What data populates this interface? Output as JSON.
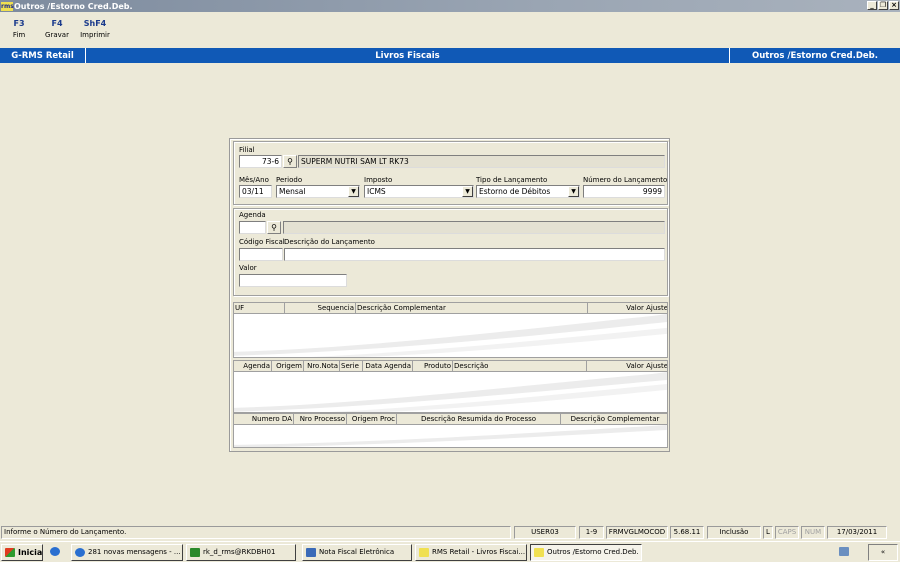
{
  "window": {
    "title": "Outros /Estorno Cred.Deb.",
    "app_icon": "rms-icon"
  },
  "function_keys": [
    {
      "key": "F3",
      "label": "Fim"
    },
    {
      "key": "F4",
      "label": "Gravar"
    },
    {
      "key": "ShF4",
      "label": "Imprimir"
    }
  ],
  "header": {
    "left": "G-RMS Retail",
    "center": "Livros Fiscais",
    "right": "Outros /Estorno Cred.Deb."
  },
  "form": {
    "filial": {
      "label": "Filial",
      "code": "73-6",
      "name": "SUPERM NUTRI SAM LT RK73"
    },
    "mes_ano": {
      "label": "Mês/Ano",
      "value": "03/11"
    },
    "periodo": {
      "label": "Periodo",
      "value": "Mensal"
    },
    "imposto": {
      "label": "Imposto",
      "value": "ICMS"
    },
    "tipo_lancamento": {
      "label": "Tipo de Lançamento",
      "value": "Estorno de Débitos"
    },
    "numero_lancamento": {
      "label": "Número do Lançamento",
      "value": "9999"
    },
    "agenda": {
      "label": "Agenda",
      "value": "",
      "desc": ""
    },
    "codigo_fiscal": {
      "label": "Código Fiscal",
      "value": ""
    },
    "descricao_lancamento": {
      "label": "Descrição do Lançamento",
      "value": ""
    },
    "valor": {
      "label": "Valor",
      "value": ""
    }
  },
  "grids": {
    "ajustes": {
      "headers": [
        "UF",
        "Sequencia",
        "Descrição Complementar",
        "Valor Ajuste"
      ]
    },
    "documentos": {
      "headers": [
        "Agenda",
        "Origem",
        "Nro.Nota",
        "Serie",
        "Data Agenda",
        "Produto",
        "Descrição",
        "Valor Ajuste"
      ]
    },
    "processos": {
      "headers": [
        "Numero DA",
        "Nro Processo",
        "Origem Proc",
        "Descrição Resumida do Processo",
        "Descrição Complementar"
      ]
    }
  },
  "status_bar": {
    "message": "Informe o Número do Lançamento.",
    "user": "USER03",
    "page": "1-9",
    "form": "FRMVGLMOCOD",
    "version": "5.68.11",
    "mode": "Inclusão",
    "l": "L",
    "caps": "CAPS",
    "num": "NUM",
    "date": "17/03/2011"
  },
  "taskbar": {
    "start": "Iniciar",
    "items": [
      "281 novas mensagens - ...",
      "rk_d_rms@RKDBH01",
      "Nota Fiscal Eletrônica",
      "RMS Retail - Livros Fiscai...",
      "Outros /Estorno Cred.Deb."
    ],
    "tray": "«"
  }
}
